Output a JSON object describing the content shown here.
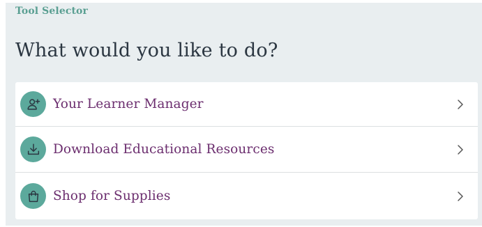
{
  "header": {
    "kicker": "Tool Selector",
    "title": "What would you like to do?"
  },
  "options": [
    {
      "label": "Your Learner Manager",
      "icon": "user-add-icon"
    },
    {
      "label": "Download Educational Resources",
      "icon": "download-icon"
    },
    {
      "label": "Shop for Supplies",
      "icon": "shopping-bag-icon"
    }
  ],
  "colors": {
    "panel_background": "#e9eef0",
    "kicker": "#5a9f92",
    "heading": "#2b3641",
    "option_label": "#6b2d6e",
    "icon_circle": "#5ca99c",
    "chevron": "#555555"
  }
}
